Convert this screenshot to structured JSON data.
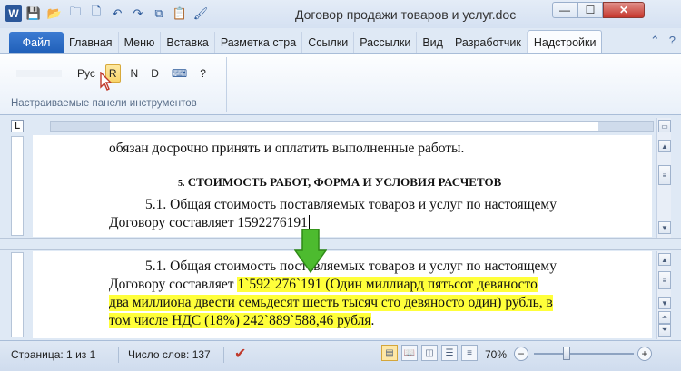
{
  "titlebar": {
    "title": "Договор продажи товаров и услуг.doc",
    "app_icon": "W",
    "minimize": "—",
    "maximize": "☐",
    "close": "✕"
  },
  "qat": [
    {
      "name": "save-icon",
      "glyph": "💾"
    },
    {
      "name": "open-icon",
      "glyph": "📂"
    },
    {
      "name": "open-folder-icon",
      "glyph": "🗀"
    },
    {
      "name": "new-icon",
      "glyph": "🗋"
    },
    {
      "name": "undo-icon",
      "glyph": "↶"
    },
    {
      "name": "redo-icon",
      "glyph": "↷"
    },
    {
      "name": "copy-icon",
      "glyph": "⧉"
    },
    {
      "name": "paste-icon",
      "glyph": "📋"
    },
    {
      "name": "format-painter-icon",
      "glyph": "🖌"
    }
  ],
  "tabs": {
    "file": "Файл",
    "home": "Главная",
    "menu": "Меню",
    "insert": "Вставка",
    "layout": "Разметка стра",
    "refs": "Ссылки",
    "mailings": "Рассылки",
    "view": "Вид",
    "developer": "Разработчик",
    "addins": "Надстройки"
  },
  "ribbon": {
    "rus": "Рус",
    "r": "R",
    "n": "N",
    "d": "D",
    "q": "?",
    "group_label": "Настраиваемые панели инструментов"
  },
  "doc1": {
    "line1": "обязан досрочно принять и оплатить выполненные работы.",
    "heading_num": "5.",
    "heading": "СТОИМОСТЬ РАБОТ, ФОРМА  И  УСЛОВИЯ РАСЧЕТОВ",
    "p1": "5.1. Общая стоимость поставляемых товаров и услуг по настоящему",
    "p2": "Договору составляет 1592276191"
  },
  "doc2": {
    "p1": "5.1. Общая стоимость поставляемых товаров и услуг по настоящему",
    "p2a": "Договору составляет ",
    "p2b": "1`592`276`191 (Один миллиард пятьсот девяносто",
    "p3": "два миллиона двести семьдесят шесть тысяч сто девяносто один) рубль, в",
    "p4": "том числе НДС (18%) 242`889`588,46 рубля",
    "p4end": "."
  },
  "status": {
    "page": "Страница: 1 из 1",
    "words": "Число слов: 137",
    "zoom": "70%",
    "zoom_minus": "−",
    "zoom_plus": "+"
  },
  "colors": {
    "highlight": "#ffff3a",
    "arrow": "#4dbb2f",
    "file_tab": "#2a6cc6"
  }
}
